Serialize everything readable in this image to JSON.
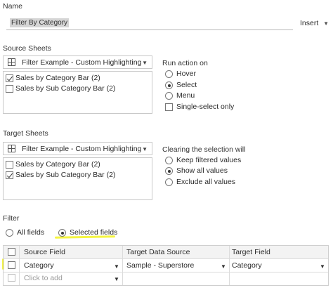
{
  "name_section": {
    "label": "Name",
    "value": "Filter By Category",
    "insert_label": "Insert"
  },
  "source_sheets": {
    "label": "Source Sheets",
    "dropdown_value": "Filter Example - Custom Highlighting",
    "items": [
      {
        "label": "Sales by Category Bar (2)",
        "checked": true
      },
      {
        "label": "Sales by Sub Category Bar (2)",
        "checked": false
      }
    ]
  },
  "run_action": {
    "label": "Run action on",
    "options": [
      "Hover",
      "Select",
      "Menu"
    ],
    "selected": "Select",
    "single_select_label": "Single-select only"
  },
  "target_sheets": {
    "label": "Target Sheets",
    "dropdown_value": "Filter Example - Custom Highlighting",
    "items": [
      {
        "label": "Sales by Category Bar (2)",
        "checked": false
      },
      {
        "label": "Sales by Sub Category Bar (2)",
        "checked": true
      }
    ]
  },
  "clearing": {
    "label": "Clearing the selection will",
    "options": [
      "Keep filtered values",
      "Show all values",
      "Exclude all values"
    ],
    "selected": "Show all values"
  },
  "filter": {
    "label": "Filter",
    "options": [
      "All fields",
      "Selected fields"
    ],
    "selected": "Selected fields",
    "table": {
      "headers": [
        "Source Field",
        "Target Data Source",
        "Target Field"
      ],
      "rows": [
        {
          "source_field": "Category",
          "target_data_source": "Sample - Superstore",
          "target_field": "Category"
        }
      ],
      "add_placeholder": "Click to add"
    }
  },
  "colors": {
    "highlight": "#f5f542",
    "border": "#c8c8c8",
    "header_bg": "#f3f3f3"
  }
}
